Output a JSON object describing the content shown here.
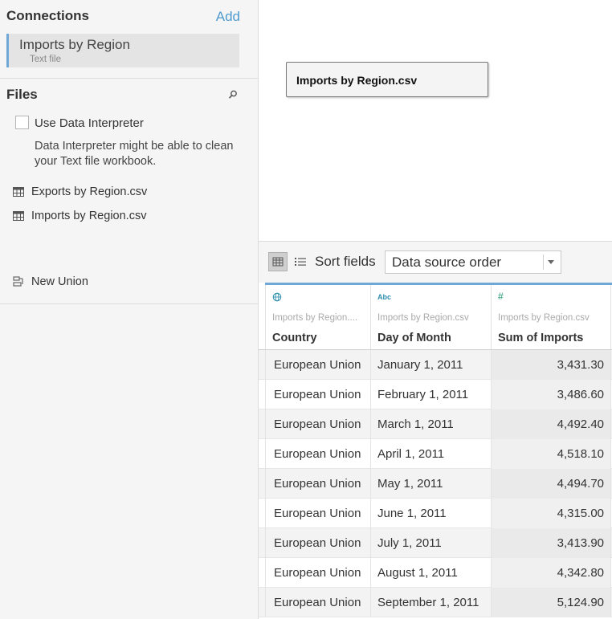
{
  "connections": {
    "title": "Connections",
    "add_label": "Add",
    "item": {
      "name": "Imports by Region",
      "type": "Text file"
    }
  },
  "files": {
    "title": "Files",
    "interpreter": {
      "label": "Use Data Interpreter",
      "checked": false,
      "description": "Data Interpreter might be able to clean your Text file workbook."
    },
    "items": [
      {
        "label": "Exports by Region.csv",
        "icon": "table-icon"
      },
      {
        "label": "Imports by Region.csv",
        "icon": "table-icon"
      }
    ],
    "new_union": {
      "label": "New Union",
      "icon": "union-icon"
    }
  },
  "canvas": {
    "table_label": "Imports by Region.csv"
  },
  "toolbar": {
    "sort_label": "Sort fields",
    "sort_value": "Data source order"
  },
  "colors": {
    "accent": "#4d9bd0",
    "selection_bar": "#6fa8d6",
    "geo_icon": "#2e8fae",
    "number_icon": "#1f9a6f"
  },
  "grid": {
    "columns": [
      {
        "type_icon": "globe-icon",
        "source": "Imports by Region....",
        "name": "Country"
      },
      {
        "type_icon": "Abc",
        "source": "Imports by Region.csv",
        "name": "Day of Month"
      },
      {
        "type_icon": "#",
        "source": "Imports by Region.csv",
        "name": "Sum of Imports"
      }
    ],
    "rows": [
      [
        "European Union",
        "January 1, 2011",
        "3,431.30"
      ],
      [
        "European Union",
        "February 1, 2011",
        "3,486.60"
      ],
      [
        "European Union",
        "March 1, 2011",
        "4,492.40"
      ],
      [
        "European Union",
        "April 1, 2011",
        "4,518.10"
      ],
      [
        "European Union",
        "May 1, 2011",
        "4,494.70"
      ],
      [
        "European Union",
        "June 1, 2011",
        "4,315.00"
      ],
      [
        "European Union",
        "July 1, 2011",
        "3,413.90"
      ],
      [
        "European Union",
        "August 1, 2011",
        "4,342.80"
      ],
      [
        "European Union",
        "September 1, 2011",
        "5,124.90"
      ]
    ]
  }
}
